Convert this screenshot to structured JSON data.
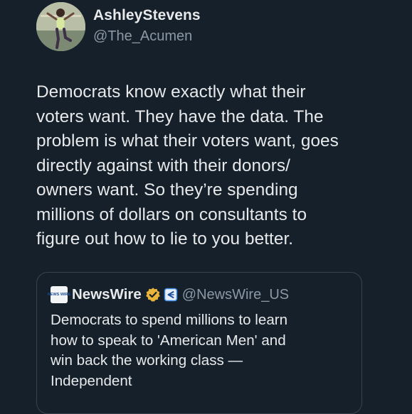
{
  "author": {
    "display_name": "AshleyStevens",
    "handle": "@The_Acumen"
  },
  "tweet": {
    "text": "Democrats know exactly what their\nvoters want. They have the data. The\nproblem is what their voters want, goes\ndirectly against with their donors/\nowners want. So they’re spending\nmillions of dollars on consultants to\nfigure out how to lie to you better."
  },
  "quote": {
    "avatar_text": "NEWS WIRE",
    "name": "NewsWire",
    "handle": "@NewsWire_US",
    "text": "Democrats to spend millions to learn\nhow to speak to 'American Men' and\nwin back the working class —\nIndependent",
    "verified_badge_icon": "gold-verified-badge-icon",
    "affiliate_icon": "affiliate-icon"
  },
  "colors": {
    "background": "#15202b",
    "text_primary": "#e7e9ea",
    "text_secondary": "#8b98a5",
    "border": "#38444d",
    "gold_badge": "#e8b53a",
    "affiliate_blue": "#3b8de8"
  }
}
